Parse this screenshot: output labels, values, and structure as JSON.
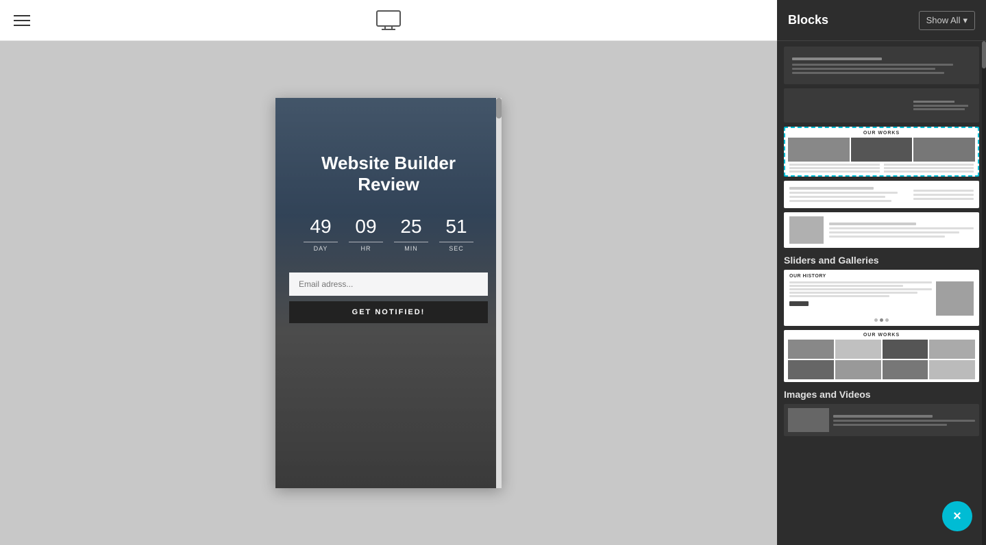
{
  "toolbar": {
    "monitor_label": "monitor"
  },
  "sidebar": {
    "title": "Blocks",
    "show_all_label": "Show All",
    "show_all_arrow": "▾",
    "sections": [
      {
        "id": "sliders",
        "label": "Sliders and Galleries"
      },
      {
        "id": "images",
        "label": "Images and Videos"
      }
    ]
  },
  "preview": {
    "title": "Website Builder Review",
    "countdown": [
      {
        "number": "49",
        "label": "DAY"
      },
      {
        "number": "09",
        "label": "HR"
      },
      {
        "number": "25",
        "label": "MIN"
      },
      {
        "number": "51",
        "label": "SEC"
      }
    ],
    "email_placeholder": "Email adress...",
    "notify_button": "GET NOTIFIED!"
  },
  "close_btn": "×"
}
